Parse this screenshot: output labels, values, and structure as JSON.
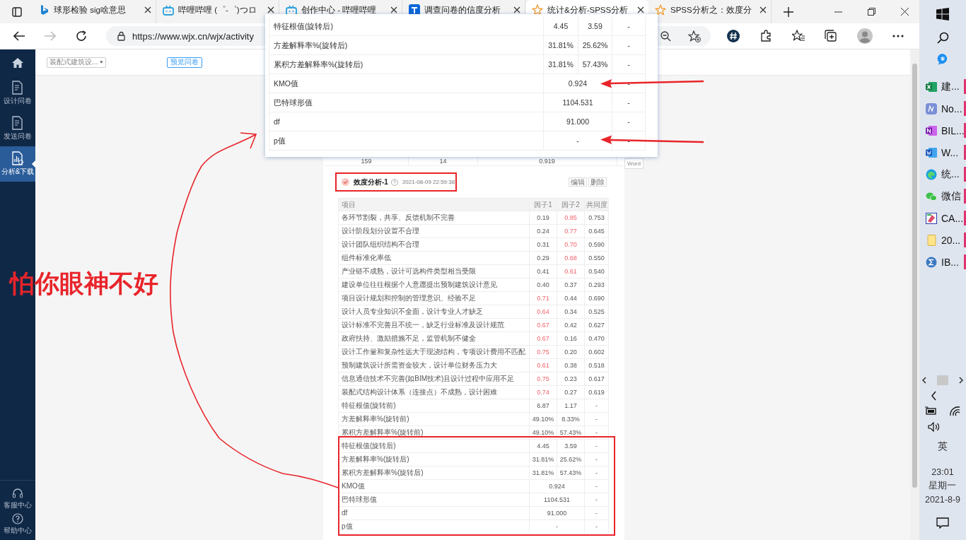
{
  "browser": {
    "tabs": [
      {
        "title": "球形检验 sig啥意思",
        "selected": false
      },
      {
        "title": "哔哩哔哩 (゜-゜)つロ",
        "selected": false
      },
      {
        "title": "创作中心 - 哔哩哔哩",
        "selected": false
      },
      {
        "title": "调查问卷的信度分析",
        "selected": false
      },
      {
        "title": "统计&分析-SPSS分析",
        "selected": true
      },
      {
        "title": "SPSS分析之：效度分",
        "selected": false
      }
    ],
    "address": "https://www.wjx.cn/wjx/activity"
  },
  "sidebar": {
    "items": [
      {
        "label": "设计问卷",
        "selected": false
      },
      {
        "label": "发送问卷",
        "selected": false
      },
      {
        "label": "分析&下载",
        "selected": true
      }
    ],
    "bottom_items": [
      "客服中心",
      "帮助中心"
    ]
  },
  "top_bar": {
    "survey_select": "装配式建筑设...",
    "preview_button": "预览问卷"
  },
  "previous_table_row": [
    "159",
    "14",
    "0.919"
  ],
  "side_button": "Word",
  "analysis": {
    "title": "效度分析-1",
    "timestamp": "2021-08-09 22:59:38",
    "actions": [
      "编辑",
      "删除"
    ],
    "columns": [
      "项目",
      "因子1",
      "因子2",
      "共同度"
    ],
    "rows": [
      {
        "kind": "values",
        "item": "各环节割裂，共享、反馈机制不完善",
        "values": [
          "0.19",
          "0.85",
          "0.753"
        ],
        "highlight": [
          false,
          true
        ]
      },
      {
        "kind": "values",
        "item": "设计阶段划分设置不合理",
        "values": [
          "0.24",
          "0.77",
          "0.645"
        ],
        "highlight": [
          false,
          true
        ]
      },
      {
        "kind": "values",
        "item": "设计团队组织结构不合理",
        "values": [
          "0.31",
          "0.70",
          "0.590"
        ],
        "highlight": [
          false,
          true
        ]
      },
      {
        "kind": "values",
        "item": "组件标准化率低",
        "values": [
          "0.29",
          "0.68",
          "0.550"
        ],
        "highlight": [
          false,
          true
        ]
      },
      {
        "kind": "values",
        "item": "产业链不成熟，设计可选构件类型相当受限",
        "values": [
          "0.41",
          "0.61",
          "0.540"
        ],
        "highlight": [
          false,
          true
        ]
      },
      {
        "kind": "values",
        "item": "建设单位往往根据个人意愿提出预制建筑设计意见",
        "values": [
          "0.40",
          "0.37",
          "0.293"
        ],
        "highlight": [
          false,
          false
        ]
      },
      {
        "kind": "values",
        "item": "项目设计规划和控制的管理意识、经验不足",
        "values": [
          "0.71",
          "0.44",
          "0.690"
        ],
        "highlight": [
          true,
          false
        ]
      },
      {
        "kind": "values",
        "item": "设计人员专业知识不全面，设计专业人才缺乏",
        "values": [
          "0.64",
          "0.34",
          "0.525"
        ],
        "highlight": [
          true,
          false
        ]
      },
      {
        "kind": "values",
        "item": "设计标准不完善且不统一，缺乏行业标准及设计规范",
        "values": [
          "0.67",
          "0.42",
          "0.627"
        ],
        "highlight": [
          true,
          false
        ]
      },
      {
        "kind": "values",
        "item": "政府扶持、激励措施不足，监管机制不健全",
        "values": [
          "0.67",
          "0.16",
          "0.470"
        ],
        "highlight": [
          true,
          false
        ]
      },
      {
        "kind": "values",
        "item": "设计工作量和复杂性远大于现浇结构，专项设计费用不匹配",
        "values": [
          "0.75",
          "0.20",
          "0.602"
        ],
        "highlight": [
          true,
          false
        ]
      },
      {
        "kind": "values",
        "item": "预制建筑设计所需资金较大，设计单位财务压力大",
        "values": [
          "0.61",
          "0.38",
          "0.518"
        ],
        "highlight": [
          true,
          false
        ]
      },
      {
        "kind": "values",
        "item": "信息通信技术不完善(如BIM技术)且设计过程中应用不足",
        "values": [
          "0.75",
          "0.23",
          "0.617"
        ],
        "highlight": [
          true,
          false
        ]
      },
      {
        "kind": "values",
        "item": "装配式结构设计体系（连接点）不成熟，设计困难",
        "values": [
          "0.74",
          "0.27",
          "0.619"
        ],
        "highlight": [
          true,
          false
        ]
      },
      {
        "kind": "values",
        "item": "特征根值(旋转前)",
        "values": [
          "6.87",
          "1.17",
          "-"
        ],
        "highlight": [
          false,
          false
        ]
      },
      {
        "kind": "values",
        "item": "方差解释率%(旋转前)",
        "values": [
          "49.10%",
          "8.33%",
          "-"
        ],
        "highlight": [
          false,
          false
        ]
      },
      {
        "kind": "values",
        "item": "累积方差解释率%(旋转前)",
        "values": [
          "49.10%",
          "57.43%",
          "-"
        ],
        "highlight": [
          false,
          false
        ]
      },
      {
        "kind": "values",
        "item": "特征根值(旋转后)",
        "values": [
          "4.45",
          "3.59",
          "-"
        ],
        "highlight": [
          false,
          false
        ]
      },
      {
        "kind": "values",
        "item": "方差解释率%(旋转后)",
        "values": [
          "31.81%",
          "25.62%",
          "-"
        ],
        "highlight": [
          false,
          false
        ]
      },
      {
        "kind": "values",
        "item": "累积方差解释率%(旋转后)",
        "values": [
          "31.81%",
          "57.43%",
          "-"
        ],
        "highlight": [
          false,
          false
        ]
      },
      {
        "kind": "merged",
        "item": "KMO值",
        "value": "0.924",
        "last": "-"
      },
      {
        "kind": "merged",
        "item": "巴特球形值",
        "value": "1104.531",
        "last": "-"
      },
      {
        "kind": "merged",
        "item": "df",
        "value": "91.000",
        "last": "-"
      },
      {
        "kind": "merged",
        "item": "p值",
        "value": "-",
        "last": "-"
      }
    ]
  },
  "popup": {
    "rows": [
      {
        "kind": "values",
        "item": "特征根值(旋转后)",
        "values": [
          "4.45",
          "3.59",
          "-"
        ]
      },
      {
        "kind": "values",
        "item": "方差解释率%(旋转后)",
        "values": [
          "31.81%",
          "25.62%",
          "-"
        ]
      },
      {
        "kind": "values",
        "item": "累积方差解释率%(旋转后)",
        "values": [
          "31.81%",
          "57.43%",
          "-"
        ]
      },
      {
        "kind": "merged",
        "item": "KMO值",
        "value": "0.924",
        "last": "-"
      },
      {
        "kind": "merged",
        "item": "巴特球形值",
        "value": "1104.531",
        "last": "-"
      },
      {
        "kind": "merged",
        "item": "df",
        "value": "91.000",
        "last": "-"
      },
      {
        "kind": "merged",
        "item": "p值",
        "value": "-",
        "last": "-"
      }
    ]
  },
  "annotation": {
    "text": "怕你眼神不好"
  },
  "taskbar": {
    "apps": [
      "建...",
      "No...",
      "BIL...",
      "W...",
      "统...",
      "微信",
      "CA...",
      "20...",
      "IB..."
    ],
    "ime": "英",
    "time": "23:01",
    "weekday": "星期一",
    "date": "2021-8-9"
  }
}
